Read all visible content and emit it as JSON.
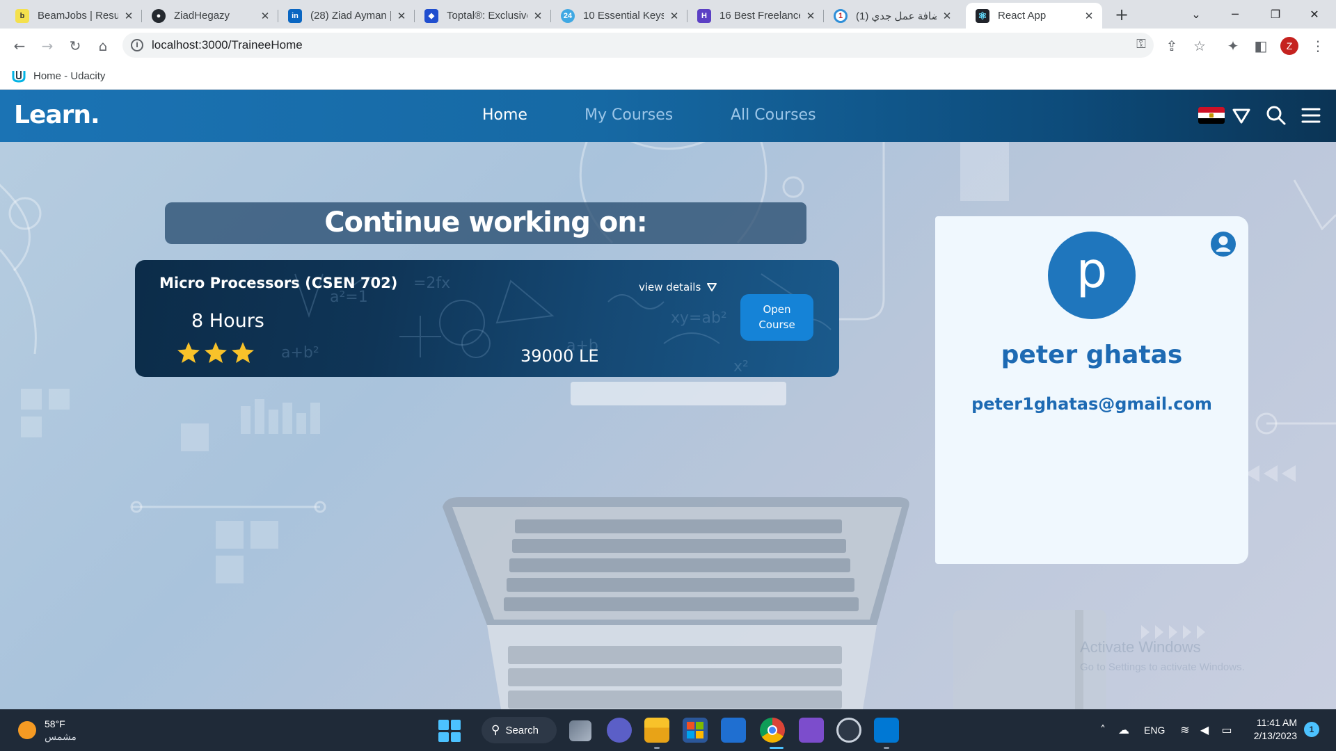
{
  "browser": {
    "tabs": [
      {
        "title": "BeamJobs | Resum",
        "favicon": "beamjobs-icon",
        "color": "#f4e04d",
        "glyph": "b"
      },
      {
        "title": "ZiadHegazy",
        "favicon": "github-icon",
        "color": "#24292f",
        "glyph": "●"
      },
      {
        "title": "(28) Ziad Ayman |",
        "favicon": "linkedin-icon",
        "color": "#0a66c2",
        "glyph": "in"
      },
      {
        "title": "Toptal®: Exclusive",
        "favicon": "toptal-icon",
        "color": "#204ecf",
        "glyph": "◆"
      },
      {
        "title": "10 Essential Keys",
        "favicon": "twentyfour-icon",
        "color": "#3fa8e3",
        "glyph": "24"
      },
      {
        "title": "16 Best Freelance",
        "favicon": "freelance-icon",
        "color": "#5b3fc4",
        "glyph": "H"
      },
      {
        "title": "(1) إضافة عمل جدي",
        "favicon": "mostaql-icon",
        "color": "#2f8fd8",
        "glyph": "◐"
      },
      {
        "title": "React App",
        "favicon": "react-icon",
        "color": "#20232a",
        "glyph": "⚛"
      }
    ],
    "active_tab_index": 7,
    "url": "localhost:3000/TraineeHome",
    "profile_initial": "Z",
    "bookmark": {
      "label": "Home - Udacity"
    }
  },
  "page": {
    "logo": "Learn.",
    "nav": {
      "home": "Home",
      "my_courses": "My Courses",
      "all_courses": "All Courses"
    },
    "continue_heading": "Continue working on:",
    "course": {
      "title": "Micro Processors (CSEN 702)",
      "hours": "8 Hours",
      "rating": 3,
      "view_details": "view details",
      "price": "39000 LE",
      "open_button_line1": "Open",
      "open_button_line2": "Course"
    },
    "profile": {
      "initial": "p",
      "name": "peter ghatas",
      "email": "peter1ghatas@gmail.com"
    },
    "colors": {
      "nav_start": "#1b73b4",
      "nav_end": "#0b3455",
      "accent": "#1583d7",
      "profile_text": "#1d6ab3"
    },
    "watermark": {
      "line1": "Activate Windows",
      "line2": "Go to Settings to activate Windows."
    }
  },
  "taskbar": {
    "weather": {
      "temp": "58°F",
      "condition": "مشمس"
    },
    "search_label": "Search",
    "language": "ENG",
    "time": "11:41 AM",
    "date": "2/13/2023",
    "notification_count": "1"
  }
}
